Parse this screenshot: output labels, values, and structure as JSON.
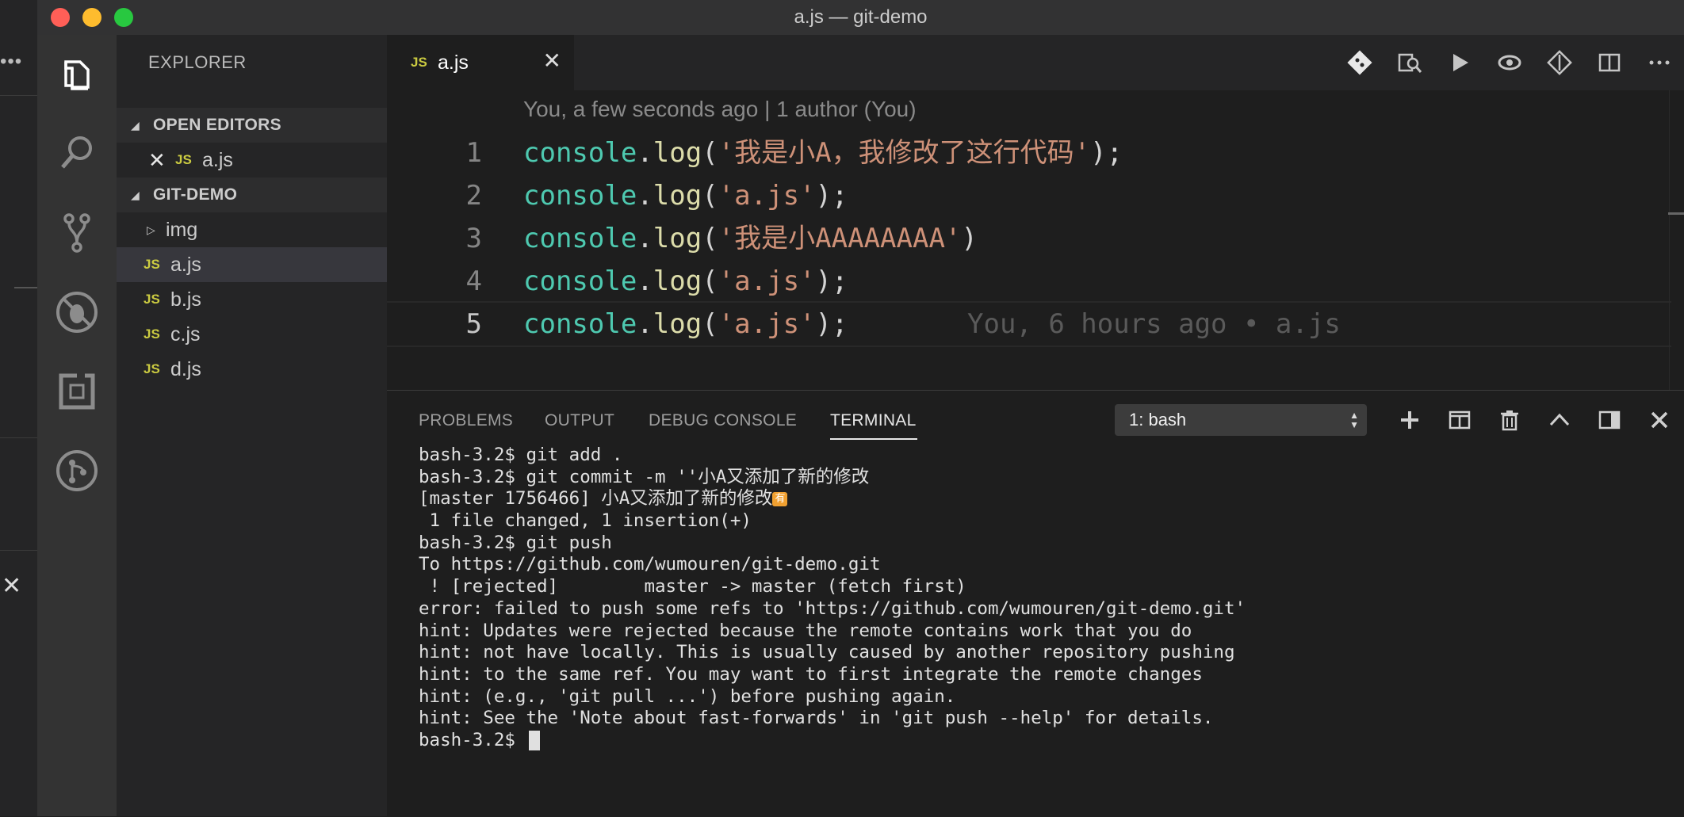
{
  "window": {
    "title": "a.js — git-demo"
  },
  "background_window": {
    "dots": "•••",
    "close_glyph": "✕"
  },
  "activity_bar": {
    "items": [
      {
        "name": "explorer-icon"
      },
      {
        "name": "search-icon"
      },
      {
        "name": "source-control-icon"
      },
      {
        "name": "debug-icon"
      },
      {
        "name": "extensions-icon"
      },
      {
        "name": "gitlens-icon"
      }
    ]
  },
  "sidebar": {
    "title": "EXPLORER",
    "open_editors": {
      "label": "OPEN EDITORS",
      "items": [
        {
          "badge": "JS",
          "name": "a.js",
          "close": "✕"
        }
      ]
    },
    "project": {
      "label": "GIT-DEMO",
      "folder": "img",
      "files": [
        {
          "badge": "JS",
          "name": "a.js"
        },
        {
          "badge": "JS",
          "name": "b.js"
        },
        {
          "badge": "JS",
          "name": "c.js"
        },
        {
          "badge": "JS",
          "name": "d.js"
        }
      ]
    }
  },
  "editor": {
    "tab": {
      "badge": "JS",
      "name": "a.js",
      "close": "✕"
    },
    "blame_header": "You, a few seconds ago | 1 author (You)",
    "lines": [
      {
        "num": "1",
        "obj": "console",
        "dot": ".",
        "fn": "log",
        "open": "(",
        "str": "'我是小A，我修改了这行代码'",
        "close": ");"
      },
      {
        "num": "2",
        "obj": "console",
        "dot": ".",
        "fn": "log",
        "open": "(",
        "str": "'a.js'",
        "close": ");"
      },
      {
        "num": "3",
        "obj": "console",
        "dot": ".",
        "fn": "log",
        "open": "(",
        "str": "'我是小AAAAAAAA'",
        "close": ")"
      },
      {
        "num": "4",
        "obj": "console",
        "dot": ".",
        "fn": "log",
        "open": "(",
        "str": "'a.js'",
        "close": ");"
      },
      {
        "num": "5",
        "obj": "console",
        "dot": ".",
        "fn": "log",
        "open": "(",
        "str": "'a.js'",
        "close": ");"
      }
    ],
    "inline_blame": "You, 6 hours ago • a.js"
  },
  "panel": {
    "tabs": [
      "PROBLEMS",
      "OUTPUT",
      "DEBUG CONSOLE",
      "TERMINAL"
    ],
    "active_tab": "TERMINAL",
    "terminal_select": "1: bash",
    "terminal_lines": [
      "bash-3.2$ git add .",
      "bash-3.2$ git commit -m ''小A又添加了新的修改",
      "[master 1756466] 小A又添加了新的修改",
      " 1 file changed, 1 insertion(+)",
      "bash-3.2$ git push",
      "To https://github.com/wumouren/git-demo.git",
      " ! [rejected]        master -> master (fetch first)",
      "error: failed to push some refs to 'https://github.com/wumouren/git-demo.git'",
      "hint: Updates were rejected because the remote contains work that you do",
      "hint: not have locally. This is usually caused by another repository pushing",
      "hint: to the same ref. You may want to first integrate the remote changes",
      "hint: (e.g., 'git pull ...') before pushing again.",
      "hint: See the 'Note about fast-forwards' in 'git push --help' for details."
    ],
    "prompt": "bash-3.2$ ",
    "ime_badge": "有"
  }
}
